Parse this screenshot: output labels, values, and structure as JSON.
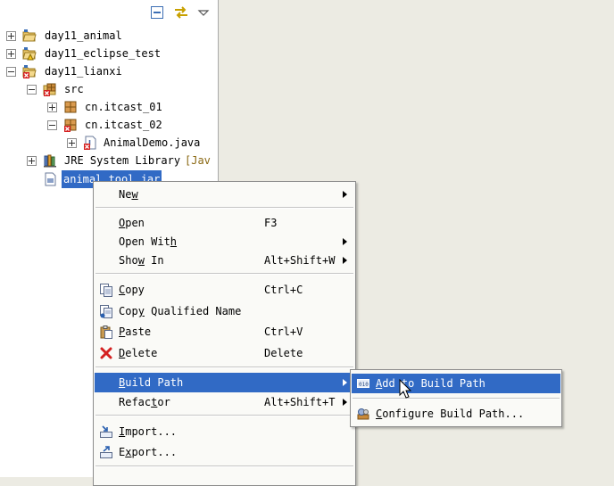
{
  "toolbar": {
    "icons": [
      "collapse-all-icon",
      "link-with-editor-icon",
      "view-menu-icon"
    ]
  },
  "tree": {
    "items": [
      {
        "label": "day11_animal",
        "icon": "java-project-icon",
        "expanded": false
      },
      {
        "label": "day11_eclipse_test",
        "icon": "java-project-icon",
        "expanded": false
      },
      {
        "label": "day11_lianxi",
        "icon": "java-project-error-icon",
        "expanded": true
      },
      {
        "label": "src",
        "icon": "source-folder-icon",
        "expanded": true
      },
      {
        "label": "cn.itcast_01",
        "icon": "package-icon",
        "expanded": false
      },
      {
        "label": "cn.itcast_02",
        "icon": "package-error-icon",
        "expanded": true
      },
      {
        "label": "AnimalDemo.java",
        "icon": "java-file-error-icon",
        "expanded": false
      },
      {
        "label": "JRE System Library",
        "decoration": "[Jav",
        "icon": "library-icon",
        "expanded": false
      },
      {
        "label": "animal_tool.jar",
        "icon": "jar-file-icon",
        "selected": true
      }
    ]
  },
  "context_menu": {
    "items": [
      {
        "label": "New",
        "mnemonic": "w",
        "shortcut": "",
        "submenu": true
      },
      {
        "label": "Open",
        "shortcut": "F3"
      },
      {
        "label": "Open With",
        "shortcut": "",
        "submenu": true
      },
      {
        "label": "Show In",
        "shortcut": "Alt+Shift+W",
        "submenu": true
      },
      {
        "label": "Copy",
        "shortcut": "Ctrl+C",
        "icon": "copy-icon"
      },
      {
        "label": "Copy Qualified Name",
        "shortcut": "",
        "icon": "copy-qualified-name-icon"
      },
      {
        "label": "Paste",
        "shortcut": "Ctrl+V",
        "icon": "paste-icon"
      },
      {
        "label": "Delete",
        "shortcut": "Delete",
        "icon": "delete-icon"
      },
      {
        "label": "Build Path",
        "shortcut": "",
        "submenu": true,
        "highlighted": true
      },
      {
        "label": "Refactor",
        "shortcut": "Alt+Shift+T",
        "submenu": true
      },
      {
        "label": "Import...",
        "shortcut": "",
        "icon": "import-icon"
      },
      {
        "label": "Export...",
        "shortcut": "",
        "icon": "export-icon"
      }
    ]
  },
  "submenu": {
    "items": [
      {
        "label": "Add to Build Path",
        "icon": "add-to-build-path-icon",
        "highlighted": true
      },
      {
        "label": "Configure Build Path...",
        "icon": "configure-build-path-icon"
      }
    ]
  },
  "colors": {
    "selection": "#316ac5",
    "menu_bg": "#fafaf7",
    "editor_bg": "#ecebe3"
  }
}
